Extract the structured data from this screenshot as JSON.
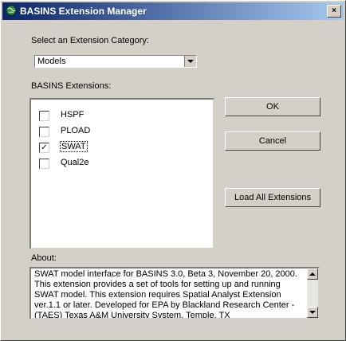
{
  "window": {
    "title": "BASINS Extension Manager",
    "close_glyph": "×"
  },
  "category": {
    "label": "Select an Extension Category:",
    "selected": "Models"
  },
  "extensions": {
    "label": "BASINS Extensions:",
    "items": [
      {
        "label": "HSPF",
        "checked": false
      },
      {
        "label": "PLOAD",
        "checked": false
      },
      {
        "label": "SWAT",
        "checked": true
      },
      {
        "label": "Qual2e",
        "checked": false
      }
    ]
  },
  "buttons": {
    "ok": "OK",
    "cancel": "Cancel",
    "load_all": "Load All Extensions"
  },
  "about": {
    "label": "About:",
    "text": "SWAT model interface for BASINS 3.0, Beta 3, November 20, 2000. This extension provides a set of tools for setting up and running  SWAT model. This extension requires Spatial Analyst Extension ver.1.1 or later. Developed for EPA by Blackland Research Center - (TAES) Texas A&M University System, Temple, TX"
  },
  "colors": {
    "title_start": "#0a246a",
    "title_end": "#a6caf0",
    "face": "#d4d0c8"
  }
}
